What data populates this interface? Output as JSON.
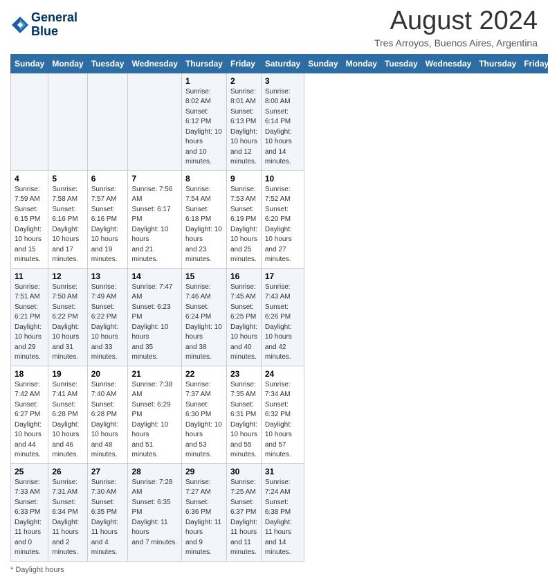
{
  "header": {
    "logo_line1": "General",
    "logo_line2": "Blue",
    "month_title": "August 2024",
    "location": "Tres Arroyos, Buenos Aires, Argentina"
  },
  "days_of_week": [
    "Sunday",
    "Monday",
    "Tuesday",
    "Wednesday",
    "Thursday",
    "Friday",
    "Saturday"
  ],
  "weeks": [
    [
      {
        "day": "",
        "info": ""
      },
      {
        "day": "",
        "info": ""
      },
      {
        "day": "",
        "info": ""
      },
      {
        "day": "",
        "info": ""
      },
      {
        "day": "1",
        "info": "Sunrise: 8:02 AM\nSunset: 6:12 PM\nDaylight: 10 hours\nand 10 minutes."
      },
      {
        "day": "2",
        "info": "Sunrise: 8:01 AM\nSunset: 6:13 PM\nDaylight: 10 hours\nand 12 minutes."
      },
      {
        "day": "3",
        "info": "Sunrise: 8:00 AM\nSunset: 6:14 PM\nDaylight: 10 hours\nand 14 minutes."
      }
    ],
    [
      {
        "day": "4",
        "info": "Sunrise: 7:59 AM\nSunset: 6:15 PM\nDaylight: 10 hours\nand 15 minutes."
      },
      {
        "day": "5",
        "info": "Sunrise: 7:58 AM\nSunset: 6:16 PM\nDaylight: 10 hours\nand 17 minutes."
      },
      {
        "day": "6",
        "info": "Sunrise: 7:57 AM\nSunset: 6:16 PM\nDaylight: 10 hours\nand 19 minutes."
      },
      {
        "day": "7",
        "info": "Sunrise: 7:56 AM\nSunset: 6:17 PM\nDaylight: 10 hours\nand 21 minutes."
      },
      {
        "day": "8",
        "info": "Sunrise: 7:54 AM\nSunset: 6:18 PM\nDaylight: 10 hours\nand 23 minutes."
      },
      {
        "day": "9",
        "info": "Sunrise: 7:53 AM\nSunset: 6:19 PM\nDaylight: 10 hours\nand 25 minutes."
      },
      {
        "day": "10",
        "info": "Sunrise: 7:52 AM\nSunset: 6:20 PM\nDaylight: 10 hours\nand 27 minutes."
      }
    ],
    [
      {
        "day": "11",
        "info": "Sunrise: 7:51 AM\nSunset: 6:21 PM\nDaylight: 10 hours\nand 29 minutes."
      },
      {
        "day": "12",
        "info": "Sunrise: 7:50 AM\nSunset: 6:22 PM\nDaylight: 10 hours\nand 31 minutes."
      },
      {
        "day": "13",
        "info": "Sunrise: 7:49 AM\nSunset: 6:22 PM\nDaylight: 10 hours\nand 33 minutes."
      },
      {
        "day": "14",
        "info": "Sunrise: 7:47 AM\nSunset: 6:23 PM\nDaylight: 10 hours\nand 35 minutes."
      },
      {
        "day": "15",
        "info": "Sunrise: 7:46 AM\nSunset: 6:24 PM\nDaylight: 10 hours\nand 38 minutes."
      },
      {
        "day": "16",
        "info": "Sunrise: 7:45 AM\nSunset: 6:25 PM\nDaylight: 10 hours\nand 40 minutes."
      },
      {
        "day": "17",
        "info": "Sunrise: 7:43 AM\nSunset: 6:26 PM\nDaylight: 10 hours\nand 42 minutes."
      }
    ],
    [
      {
        "day": "18",
        "info": "Sunrise: 7:42 AM\nSunset: 6:27 PM\nDaylight: 10 hours\nand 44 minutes."
      },
      {
        "day": "19",
        "info": "Sunrise: 7:41 AM\nSunset: 6:28 PM\nDaylight: 10 hours\nand 46 minutes."
      },
      {
        "day": "20",
        "info": "Sunrise: 7:40 AM\nSunset: 6:28 PM\nDaylight: 10 hours\nand 48 minutes."
      },
      {
        "day": "21",
        "info": "Sunrise: 7:38 AM\nSunset: 6:29 PM\nDaylight: 10 hours\nand 51 minutes."
      },
      {
        "day": "22",
        "info": "Sunrise: 7:37 AM\nSunset: 6:30 PM\nDaylight: 10 hours\nand 53 minutes."
      },
      {
        "day": "23",
        "info": "Sunrise: 7:35 AM\nSunset: 6:31 PM\nDaylight: 10 hours\nand 55 minutes."
      },
      {
        "day": "24",
        "info": "Sunrise: 7:34 AM\nSunset: 6:32 PM\nDaylight: 10 hours\nand 57 minutes."
      }
    ],
    [
      {
        "day": "25",
        "info": "Sunrise: 7:33 AM\nSunset: 6:33 PM\nDaylight: 11 hours\nand 0 minutes."
      },
      {
        "day": "26",
        "info": "Sunrise: 7:31 AM\nSunset: 6:34 PM\nDaylight: 11 hours\nand 2 minutes."
      },
      {
        "day": "27",
        "info": "Sunrise: 7:30 AM\nSunset: 6:35 PM\nDaylight: 11 hours\nand 4 minutes."
      },
      {
        "day": "28",
        "info": "Sunrise: 7:28 AM\nSunset: 6:35 PM\nDaylight: 11 hours\nand 7 minutes."
      },
      {
        "day": "29",
        "info": "Sunrise: 7:27 AM\nSunset: 6:36 PM\nDaylight: 11 hours\nand 9 minutes."
      },
      {
        "day": "30",
        "info": "Sunrise: 7:25 AM\nSunset: 6:37 PM\nDaylight: 11 hours\nand 11 minutes."
      },
      {
        "day": "31",
        "info": "Sunrise: 7:24 AM\nSunset: 6:38 PM\nDaylight: 11 hours\nand 14 minutes."
      }
    ]
  ],
  "footer": {
    "note": "Daylight hours"
  }
}
